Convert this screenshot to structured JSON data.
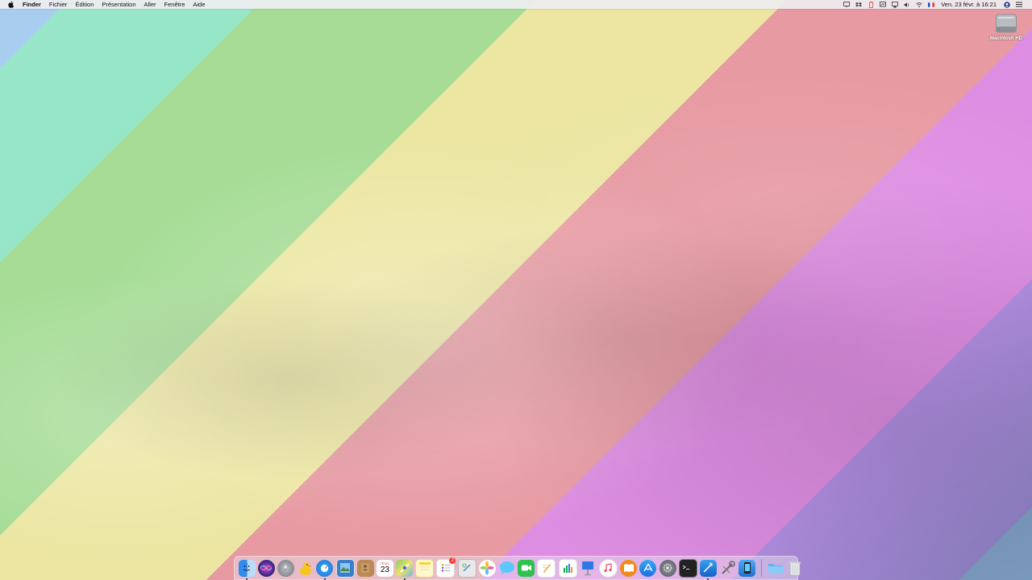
{
  "menubar": {
    "apple_icon": "apple-logo-icon",
    "app_name": "Finder",
    "items": [
      "Fichier",
      "Édition",
      "Présentation",
      "Aller",
      "Fenêtre",
      "Aide"
    ],
    "status_icons": [
      "screen-icon",
      "dropbox-icon",
      "battery-icon",
      "display-icon",
      "airplay-icon",
      "volume-icon",
      "wifi-icon",
      "flag-fr-icon"
    ],
    "clock": "Ven. 23 févr. à 16:21",
    "extra_icons": [
      "user-icon",
      "list-icon"
    ]
  },
  "desktop": {
    "hd_label": "Macintosh HD"
  },
  "dock": {
    "apps": [
      {
        "name": "Finder",
        "icon": "finder-icon",
        "running": true
      },
      {
        "name": "Siri",
        "icon": "siri-icon",
        "running": false
      },
      {
        "name": "Launchpad",
        "icon": "launchpad-icon",
        "running": false
      },
      {
        "name": "Cyberduck",
        "icon": "duck-icon",
        "running": false
      },
      {
        "name": "Safari",
        "icon": "safari-icon",
        "running": true
      },
      {
        "name": "Preview",
        "icon": "preview-icon",
        "running": false
      },
      {
        "name": "Contacts",
        "icon": "contacts-icon",
        "running": false
      },
      {
        "name": "Calendar",
        "icon": "calendar-icon",
        "running": false,
        "month": "FÉVR.",
        "day": "23"
      },
      {
        "name": "Maps",
        "icon": "maps-icon",
        "running": true
      },
      {
        "name": "Notes",
        "icon": "notes-icon",
        "running": false
      },
      {
        "name": "Reminders",
        "icon": "reminders-icon",
        "running": false,
        "badge": "2"
      },
      {
        "name": "Script Editor",
        "icon": "script-icon",
        "running": false
      },
      {
        "name": "Photos",
        "icon": "photos-icon",
        "running": false
      },
      {
        "name": "Messages",
        "icon": "messages-icon",
        "running": false
      },
      {
        "name": "FaceTime",
        "icon": "facetime-icon",
        "running": false
      },
      {
        "name": "Pages",
        "icon": "pages-icon",
        "running": false
      },
      {
        "name": "Numbers",
        "icon": "numbers-icon",
        "running": false
      },
      {
        "name": "Keynote",
        "icon": "keynote-icon",
        "running": false
      },
      {
        "name": "Music",
        "icon": "music-icon",
        "running": false
      },
      {
        "name": "Books",
        "icon": "books-icon",
        "running": false
      },
      {
        "name": "App Store",
        "icon": "appstore-icon",
        "running": false
      },
      {
        "name": "System Preferences",
        "icon": "settings-icon",
        "running": false
      },
      {
        "name": "Terminal",
        "icon": "terminal-icon",
        "running": false
      },
      {
        "name": "Xcode",
        "icon": "xcode-icon",
        "running": true
      },
      {
        "name": "Utility",
        "icon": "utility-icon",
        "running": false
      },
      {
        "name": "Simulator",
        "icon": "simulator-icon",
        "running": false
      }
    ],
    "right_items": [
      {
        "name": "Downloads",
        "icon": "folder-icon"
      },
      {
        "name": "Trash",
        "icon": "trash-icon"
      }
    ]
  }
}
